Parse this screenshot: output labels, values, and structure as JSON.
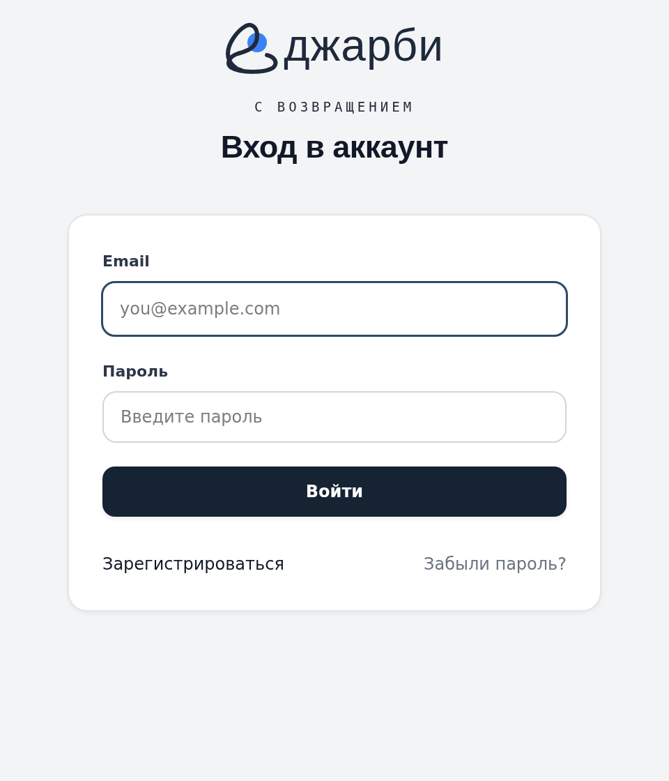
{
  "logo": {
    "wordmark": "джарби"
  },
  "header": {
    "eyebrow": "С ВОЗВРАЩЕНИЕМ",
    "title": "Вход в аккаунт"
  },
  "form": {
    "fields": [
      {
        "label": "Email",
        "placeholder": "you@example.com",
        "focused": true
      },
      {
        "label": "Пароль",
        "placeholder": "Введите пароль",
        "focused": false
      }
    ],
    "submit": "Войти",
    "links": [
      {
        "kind": "primary",
        "label": "Зарегистрироваться"
      },
      {
        "kind": "muted",
        "label": "Забыли пароль?"
      }
    ]
  }
}
